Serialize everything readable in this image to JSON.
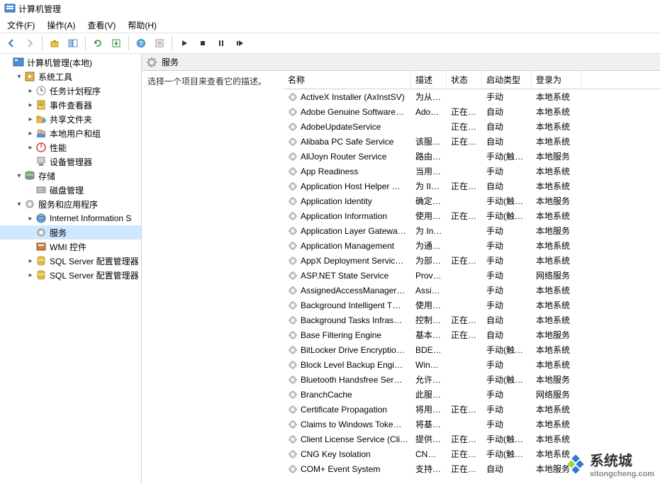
{
  "title": "计算机管理",
  "menubar": [
    "文件(F)",
    "操作(A)",
    "查看(V)",
    "帮助(H)"
  ],
  "tree": [
    {
      "label": "计算机管理(本地)",
      "indent": 0,
      "expander": "",
      "icon": "mmc"
    },
    {
      "label": "系统工具",
      "indent": 1,
      "expander": "▾",
      "icon": "wrench"
    },
    {
      "label": "任务计划程序",
      "indent": 2,
      "expander": "▸",
      "icon": "task"
    },
    {
      "label": "事件查看器",
      "indent": 2,
      "expander": "▸",
      "icon": "event"
    },
    {
      "label": "共享文件夹",
      "indent": 2,
      "expander": "▸",
      "icon": "share"
    },
    {
      "label": "本地用户和组",
      "indent": 2,
      "expander": "▸",
      "icon": "users"
    },
    {
      "label": "性能",
      "indent": 2,
      "expander": "▸",
      "icon": "perf"
    },
    {
      "label": "设备管理器",
      "indent": 2,
      "expander": "",
      "icon": "device"
    },
    {
      "label": "存储",
      "indent": 1,
      "expander": "▾",
      "icon": "storage"
    },
    {
      "label": "磁盘管理",
      "indent": 2,
      "expander": "",
      "icon": "disk"
    },
    {
      "label": "服务和应用程序",
      "indent": 1,
      "expander": "▾",
      "icon": "svcapp"
    },
    {
      "label": "Internet Information S",
      "indent": 2,
      "expander": "▸",
      "icon": "iis"
    },
    {
      "label": "服务",
      "indent": 2,
      "expander": "",
      "icon": "gear",
      "selected": true
    },
    {
      "label": "WMI 控件",
      "indent": 2,
      "expander": "",
      "icon": "wmi"
    },
    {
      "label": "SQL Server 配置管理器",
      "indent": 2,
      "expander": "▸",
      "icon": "sql"
    },
    {
      "label": "SQL Server 配置管理器",
      "indent": 2,
      "expander": "▸",
      "icon": "sql"
    }
  ],
  "panel_title": "服务",
  "desc_pane_text": "选择一个项目来查看它的描述。",
  "columns": {
    "name": "名称",
    "desc": "描述",
    "status": "状态",
    "start": "启动类型",
    "logon": "登录为"
  },
  "services": [
    {
      "name": "ActiveX Installer (AxInstSV)",
      "desc": "为从 …",
      "status": "",
      "start": "手动",
      "logon": "本地系统"
    },
    {
      "name": "Adobe Genuine Software…",
      "desc": "Ado…",
      "status": "正在…",
      "start": "自动",
      "logon": "本地系统"
    },
    {
      "name": "AdobeUpdateService",
      "desc": "",
      "status": "正在…",
      "start": "自动",
      "logon": "本地系统"
    },
    {
      "name": "Alibaba PC Safe Service",
      "desc": "该服…",
      "status": "正在…",
      "start": "自动",
      "logon": "本地系统"
    },
    {
      "name": "AllJoyn Router Service",
      "desc": "路由…",
      "status": "",
      "start": "手动(触发…",
      "logon": "本地服务"
    },
    {
      "name": "App Readiness",
      "desc": "当用…",
      "status": "",
      "start": "手动",
      "logon": "本地系统"
    },
    {
      "name": "Application Host Helper …",
      "desc": "为 II…",
      "status": "正在…",
      "start": "自动",
      "logon": "本地系统"
    },
    {
      "name": "Application Identity",
      "desc": "确定…",
      "status": "",
      "start": "手动(触发…",
      "logon": "本地服务"
    },
    {
      "name": "Application Information",
      "desc": "使用…",
      "status": "正在…",
      "start": "手动(触发…",
      "logon": "本地系统"
    },
    {
      "name": "Application Layer Gatewa…",
      "desc": "为 In…",
      "status": "",
      "start": "手动",
      "logon": "本地服务"
    },
    {
      "name": "Application Management",
      "desc": "为通…",
      "status": "",
      "start": "手动",
      "logon": "本地系统"
    },
    {
      "name": "AppX Deployment Servic…",
      "desc": "为部…",
      "status": "正在…",
      "start": "手动",
      "logon": "本地系统"
    },
    {
      "name": "ASP.NET State Service",
      "desc": "Prov…",
      "status": "",
      "start": "手动",
      "logon": "网络服务"
    },
    {
      "name": "AssignedAccessManager…",
      "desc": "Assi…",
      "status": "",
      "start": "手动",
      "logon": "本地系统"
    },
    {
      "name": "Background Intelligent T…",
      "desc": "使用…",
      "status": "",
      "start": "手动",
      "logon": "本地系统"
    },
    {
      "name": "Background Tasks Infras…",
      "desc": "控制…",
      "status": "正在…",
      "start": "自动",
      "logon": "本地系统"
    },
    {
      "name": "Base Filtering Engine",
      "desc": "基本…",
      "status": "正在…",
      "start": "自动",
      "logon": "本地服务"
    },
    {
      "name": "BitLocker Drive Encryptio…",
      "desc": "BDE…",
      "status": "",
      "start": "手动(触发…",
      "logon": "本地系统"
    },
    {
      "name": "Block Level Backup Engi…",
      "desc": "Win…",
      "status": "",
      "start": "手动",
      "logon": "本地系统"
    },
    {
      "name": "Bluetooth Handsfree Ser…",
      "desc": "允许…",
      "status": "",
      "start": "手动(触发…",
      "logon": "本地服务"
    },
    {
      "name": "BranchCache",
      "desc": "此服…",
      "status": "",
      "start": "手动",
      "logon": "网络服务"
    },
    {
      "name": "Certificate Propagation",
      "desc": "将用…",
      "status": "正在…",
      "start": "手动",
      "logon": "本地系统"
    },
    {
      "name": "Claims to Windows Toke…",
      "desc": "将基…",
      "status": "",
      "start": "手动",
      "logon": "本地系统"
    },
    {
      "name": "Client License Service (Cli…",
      "desc": "提供…",
      "status": "正在…",
      "start": "手动(触发…",
      "logon": "本地系统"
    },
    {
      "name": "CNG Key Isolation",
      "desc": "CNG…",
      "status": "正在…",
      "start": "手动(触发…",
      "logon": "本地系统"
    },
    {
      "name": "COM+ Event System",
      "desc": "支持…",
      "status": "正在…",
      "start": "自动",
      "logon": "本地服务"
    }
  ],
  "watermark": {
    "text": "系统城",
    "sub": "xitongcheng.com"
  }
}
